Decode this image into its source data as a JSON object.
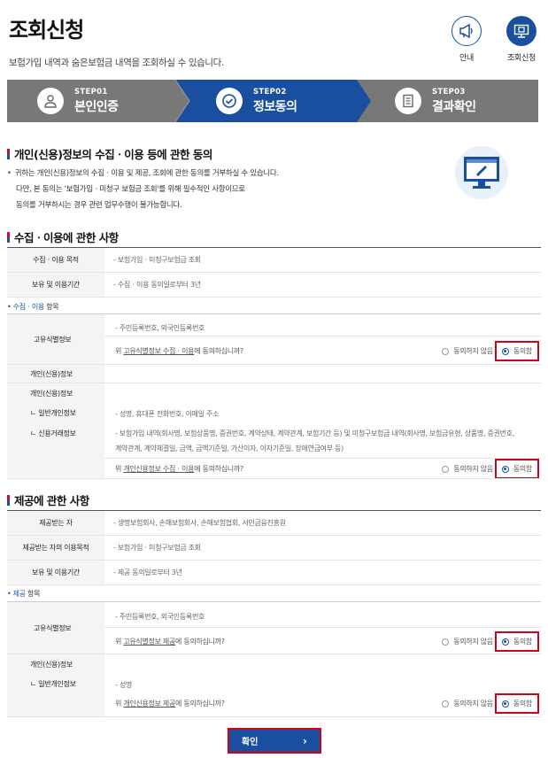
{
  "header": {
    "title": "조회신청",
    "subtitle": "보험가입 내역과 숨은보험금 내역을 조회하실 수 있습니다."
  },
  "top_icons": [
    {
      "label": "안내",
      "icon": "megaphone-icon"
    },
    {
      "label": "조회신청",
      "icon": "monitor-icon"
    }
  ],
  "steps": [
    {
      "num": "STEP01",
      "label": "본인인증",
      "icon": "person-icon"
    },
    {
      "num": "STEP02",
      "label": "정보동의",
      "icon": "check-circle-icon"
    },
    {
      "num": "STEP03",
      "label": "결과확인",
      "icon": "document-icon"
    }
  ],
  "consent": {
    "title": "개인(신용)정보의 수집ㆍ이용 등에 관한 동의",
    "desc": [
      "귀하는 개인(신용)정보의 수집ㆍ이용 및 제공, 조회에 관한 동의를 거부하실 수 있습니다.",
      "다만, 본 동의는 '보험가입ㆍ미청구 보험금 조회'를 위해 필수적인 사항이므로",
      "동의를 거부하시는 경우 관련 업무수행이 불가능합니다."
    ]
  },
  "collect": {
    "title": "수집ㆍ이용에 관한 사항",
    "rows": [
      {
        "label": "수집ㆍ이용 목적",
        "value": "- 보험가입ㆍ미청구보험금 조회"
      },
      {
        "label": "보유 및 이용기간",
        "value": "- 수집ㆍ이용 동의일로부터 3년"
      }
    ],
    "items_title_a": "수집ㆍ이용",
    "items_title_b": " 항목",
    "unique_label": "고유식별정보",
    "unique_value": "- 주민등록번호, 외국인등록번호",
    "unique_q_pre": "위 ",
    "unique_q_link": "고유식별정보 수집ㆍ이용",
    "unique_q_post": "에 동의하십니까?",
    "credit_label": "개인(신용)정보",
    "credit_label2": "개인(신용)정보",
    "general_label": "ㄴ 일반개인정보",
    "credit_trade_label": "ㄴ 신용거래정보",
    "general_value": "- 성명, 휴대폰 전화번호, 이메일 주소",
    "trade_value_1": "- 보험가입 내역(회사명, 보험상품명, 증권번호, 계약상태, 계약관계, 보험기간 등) 및 미청구보험금 내역(회사명, 보험금유형, 상품명, 증권번호,",
    "trade_value_2": "계약관계, 계약체결일, 금액, 금액기준일, 가산이자, 이자기준일, 장애연금여부 등)",
    "credit_q_pre": "위 ",
    "credit_q_link": "개인신용정보 수집ㆍ이용",
    "credit_q_post": "에 동의하십니까?"
  },
  "provide": {
    "title": "제공에 관한 사항",
    "rows": [
      {
        "label": "제공받는 자",
        "value": "- 생명보험회사, 손해보험회사, 손해보험협회, 서민금융진흥원"
      },
      {
        "label": "제공받는 자의 이용목적",
        "value": "- 보험가입ㆍ미청구보험금 조회"
      },
      {
        "label": "보유 및 이용기간",
        "value": "- 제공 동의일로부터 3년"
      }
    ],
    "items_title_a": "제공",
    "items_title_b": " 항목",
    "unique_label": "고유식별정보",
    "unique_value": "- 주민등록번호, 외국인등록번호",
    "unique_q_pre": "위 ",
    "unique_q_link": "고유식별정보 제공",
    "unique_q_post": "에 동의하십니까?",
    "credit_label": "개인(신용)정보",
    "general_label": "ㄴ 일반개인정보",
    "general_value": "- 성명",
    "credit_q_pre": "위 ",
    "credit_q_link": "개인신용정보 제공",
    "credit_q_post": "에 동의하십니까?"
  },
  "radio": {
    "disagree": "동의하지 않음",
    "agree": "동의함",
    "selected": "agree"
  },
  "confirm_button": "확인",
  "colors": {
    "primary": "#1a4fa0",
    "highlight": "#d0021b",
    "step_inactive": "#787878"
  }
}
